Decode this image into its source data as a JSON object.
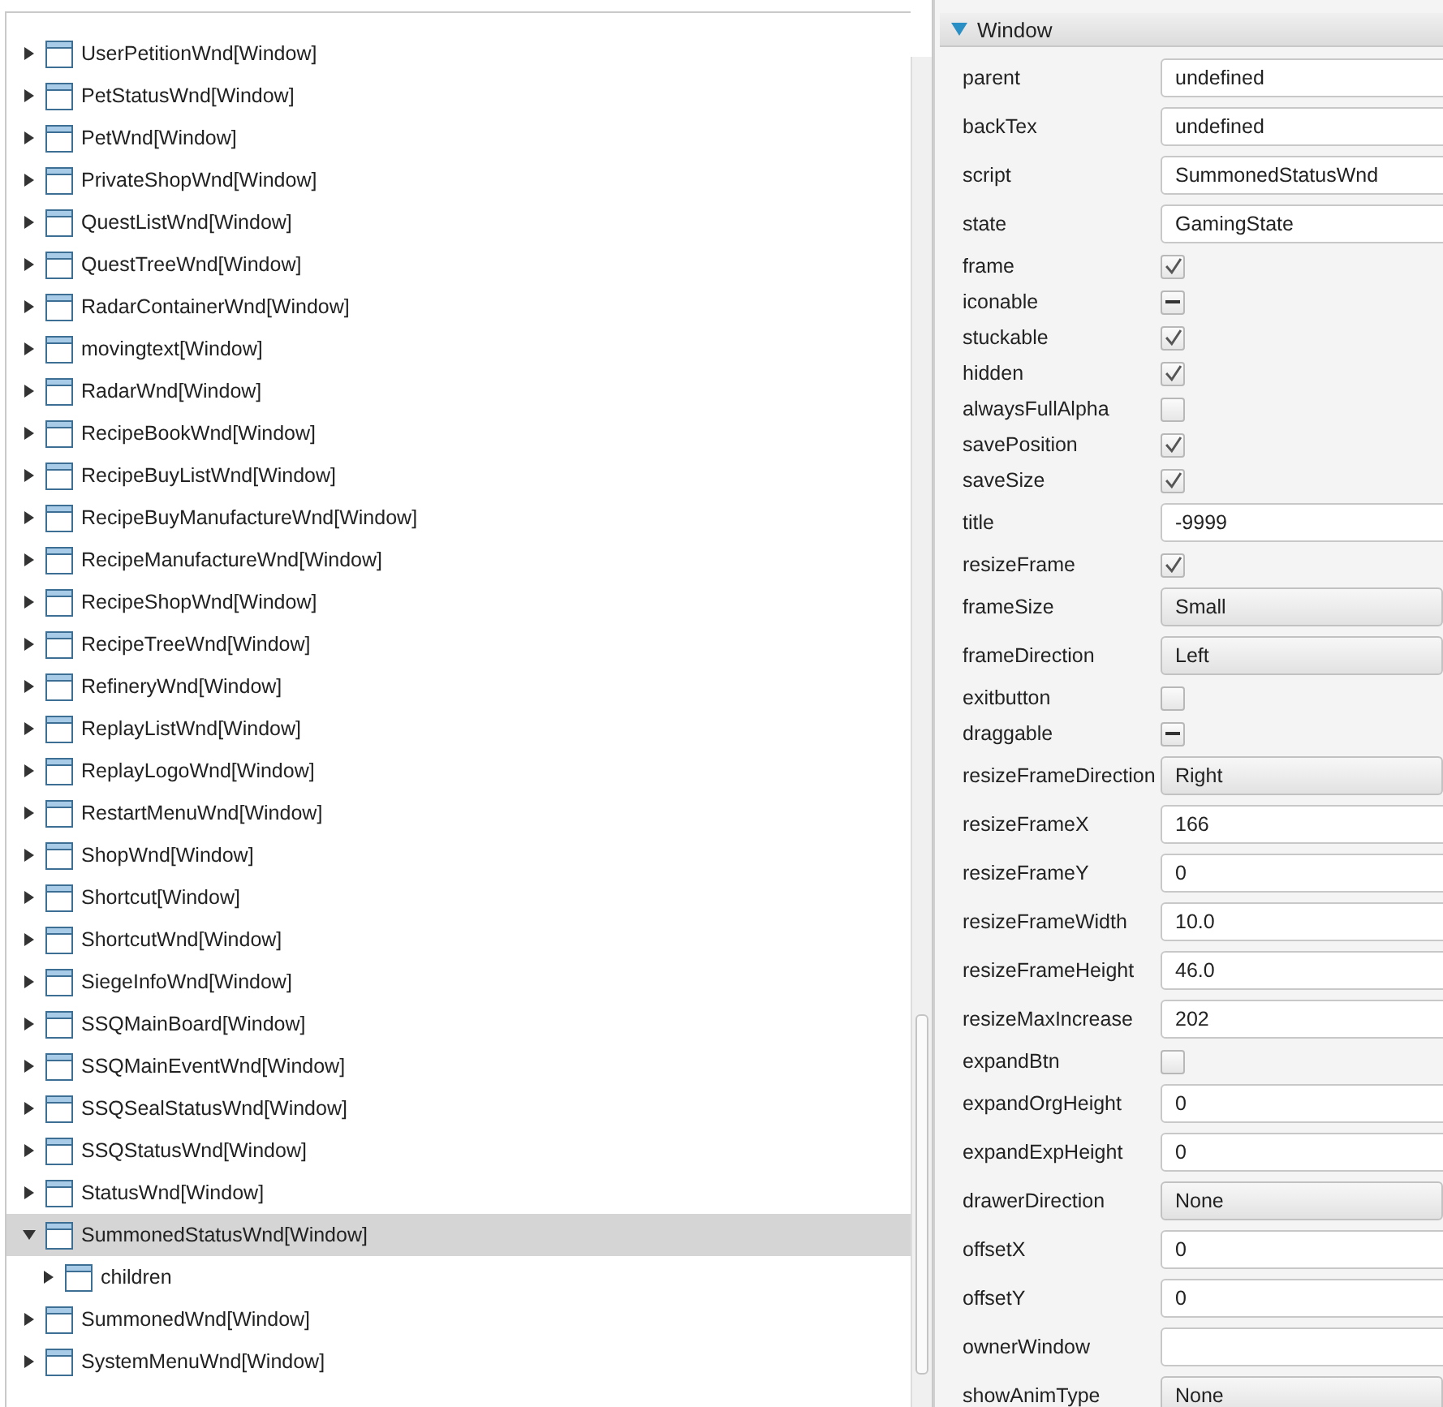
{
  "tree": {
    "items": [
      {
        "label": "UserPetitionWnd[Window]",
        "selected": false,
        "expanded": false
      },
      {
        "label": "PetStatusWnd[Window]",
        "selected": false,
        "expanded": false
      },
      {
        "label": "PetWnd[Window]",
        "selected": false,
        "expanded": false
      },
      {
        "label": "PrivateShopWnd[Window]",
        "selected": false,
        "expanded": false
      },
      {
        "label": "QuestListWnd[Window]",
        "selected": false,
        "expanded": false
      },
      {
        "label": "QuestTreeWnd[Window]",
        "selected": false,
        "expanded": false
      },
      {
        "label": "RadarContainerWnd[Window]",
        "selected": false,
        "expanded": false
      },
      {
        "label": "movingtext[Window]",
        "selected": false,
        "expanded": false
      },
      {
        "label": "RadarWnd[Window]",
        "selected": false,
        "expanded": false
      },
      {
        "label": "RecipeBookWnd[Window]",
        "selected": false,
        "expanded": false
      },
      {
        "label": "RecipeBuyListWnd[Window]",
        "selected": false,
        "expanded": false
      },
      {
        "label": "RecipeBuyManufactureWnd[Window]",
        "selected": false,
        "expanded": false
      },
      {
        "label": "RecipeManufactureWnd[Window]",
        "selected": false,
        "expanded": false
      },
      {
        "label": "RecipeShopWnd[Window]",
        "selected": false,
        "expanded": false
      },
      {
        "label": "RecipeTreeWnd[Window]",
        "selected": false,
        "expanded": false
      },
      {
        "label": "RefineryWnd[Window]",
        "selected": false,
        "expanded": false
      },
      {
        "label": "ReplayListWnd[Window]",
        "selected": false,
        "expanded": false
      },
      {
        "label": "ReplayLogoWnd[Window]",
        "selected": false,
        "expanded": false
      },
      {
        "label": "RestartMenuWnd[Window]",
        "selected": false,
        "expanded": false
      },
      {
        "label": "ShopWnd[Window]",
        "selected": false,
        "expanded": false
      },
      {
        "label": "Shortcut[Window]",
        "selected": false,
        "expanded": false
      },
      {
        "label": "ShortcutWnd[Window]",
        "selected": false,
        "expanded": false
      },
      {
        "label": "SiegeInfoWnd[Window]",
        "selected": false,
        "expanded": false
      },
      {
        "label": "SSQMainBoard[Window]",
        "selected": false,
        "expanded": false
      },
      {
        "label": "SSQMainEventWnd[Window]",
        "selected": false,
        "expanded": false
      },
      {
        "label": "SSQSealStatusWnd[Window]",
        "selected": false,
        "expanded": false
      },
      {
        "label": "SSQStatusWnd[Window]",
        "selected": false,
        "expanded": false
      },
      {
        "label": "StatusWnd[Window]",
        "selected": false,
        "expanded": false
      },
      {
        "label": "SummonedStatusWnd[Window]",
        "selected": true,
        "expanded": true,
        "children": [
          {
            "label": "children",
            "selected": false,
            "expanded": false
          }
        ]
      },
      {
        "label": "SummonedWnd[Window]",
        "selected": false,
        "expanded": false
      },
      {
        "label": "SystemMenuWnd[Window]",
        "selected": false,
        "expanded": false
      }
    ]
  },
  "properties": {
    "section": {
      "title": "Window",
      "expanded": true
    },
    "rows": [
      {
        "kind": "text",
        "name": "parent",
        "value": "undefined"
      },
      {
        "kind": "text",
        "name": "backTex",
        "value": "undefined"
      },
      {
        "kind": "text",
        "name": "script",
        "value": "SummonedStatusWnd"
      },
      {
        "kind": "text",
        "name": "state",
        "value": "GamingState"
      },
      {
        "kind": "check",
        "name": "frame",
        "checked": true,
        "indeterminate": false
      },
      {
        "kind": "check",
        "name": "iconable",
        "checked": false,
        "indeterminate": true
      },
      {
        "kind": "check",
        "name": "stuckable",
        "checked": true,
        "indeterminate": false
      },
      {
        "kind": "check",
        "name": "hidden",
        "checked": true,
        "indeterminate": false
      },
      {
        "kind": "check",
        "name": "alwaysFullAlpha",
        "checked": false,
        "indeterminate": false
      },
      {
        "kind": "check",
        "name": "savePosition",
        "checked": true,
        "indeterminate": false
      },
      {
        "kind": "check",
        "name": "saveSize",
        "checked": true,
        "indeterminate": false
      },
      {
        "kind": "text",
        "name": "title",
        "value": "-9999"
      },
      {
        "kind": "check",
        "name": "resizeFrame",
        "checked": true,
        "indeterminate": false
      },
      {
        "kind": "select",
        "name": "frameSize",
        "value": "Small"
      },
      {
        "kind": "select",
        "name": "frameDirection",
        "value": "Left"
      },
      {
        "kind": "check",
        "name": "exitbutton",
        "checked": false,
        "indeterminate": false
      },
      {
        "kind": "check",
        "name": "draggable",
        "checked": false,
        "indeterminate": true
      },
      {
        "kind": "select",
        "name": "resizeFrameDirection",
        "value": "Right"
      },
      {
        "kind": "text",
        "name": "resizeFrameX",
        "value": "166"
      },
      {
        "kind": "text",
        "name": "resizeFrameY",
        "value": "0"
      },
      {
        "kind": "text",
        "name": "resizeFrameWidth",
        "value": "10.0"
      },
      {
        "kind": "text",
        "name": "resizeFrameHeight",
        "value": "46.0"
      },
      {
        "kind": "text",
        "name": "resizeMaxIncrease",
        "value": "202"
      },
      {
        "kind": "check",
        "name": "expandBtn",
        "checked": false,
        "indeterminate": false
      },
      {
        "kind": "text",
        "name": "expandOrgHeight",
        "value": "0"
      },
      {
        "kind": "text",
        "name": "expandExpHeight",
        "value": "0"
      },
      {
        "kind": "select",
        "name": "drawerDirection",
        "value": "None"
      },
      {
        "kind": "text",
        "name": "offsetX",
        "value": "0"
      },
      {
        "kind": "text",
        "name": "offsetY",
        "value": "0"
      },
      {
        "kind": "text",
        "name": "ownerWindow",
        "value": ""
      },
      {
        "kind": "select",
        "name": "showAnimType",
        "value": "None"
      }
    ]
  }
}
